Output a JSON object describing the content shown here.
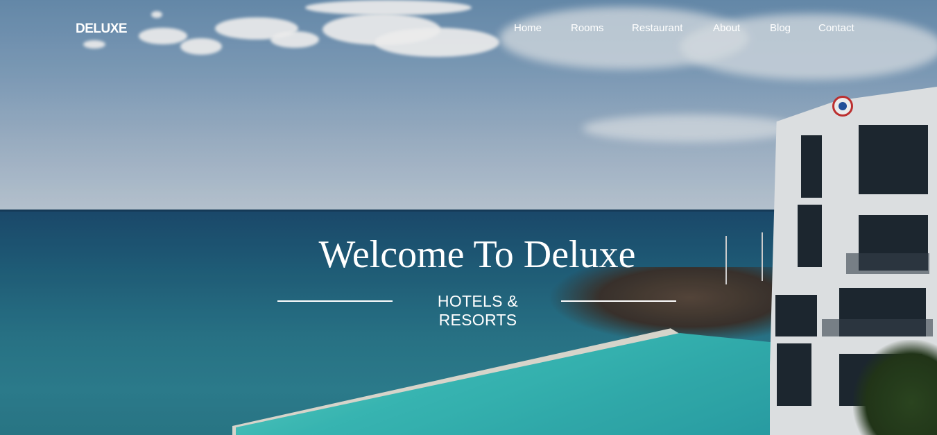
{
  "brand": {
    "name": "DELUXE"
  },
  "nav": {
    "items": [
      {
        "label": "Home"
      },
      {
        "label": "Rooms"
      },
      {
        "label": "Restaurant"
      },
      {
        "label": "About"
      },
      {
        "label": "Blog"
      },
      {
        "label": "Contact"
      }
    ]
  },
  "hero": {
    "headline": "Welcome To Deluxe",
    "subheading": "HOTELS & RESORTS"
  },
  "colors": {
    "text": "#ffffff",
    "sky": "#86a6c4",
    "sea": "#21627f",
    "pool": "#3cc4c0"
  }
}
